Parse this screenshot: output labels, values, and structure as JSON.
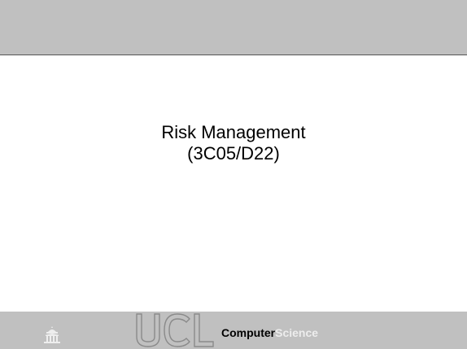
{
  "slide": {
    "title_line_1": "Risk Management",
    "title_line_2": "(3C05/D22)"
  },
  "footer": {
    "logo_text": "UCL",
    "dept_strong": "Computer",
    "dept_light": "Science"
  },
  "colors": {
    "band": "#c0c0c0",
    "border": "#555555",
    "text": "#000000",
    "footer_light": "#ededed",
    "logo_outline": "#8a8a8a"
  }
}
